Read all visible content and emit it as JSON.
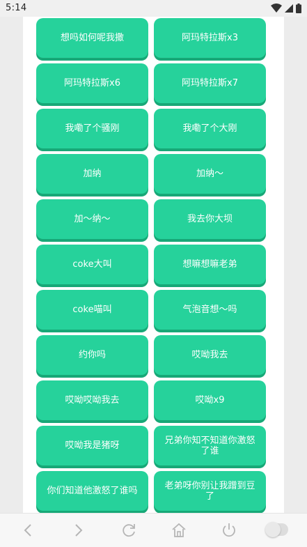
{
  "status_bar": {
    "time": "5:14",
    "icons": [
      "wifi-icon",
      "signal-icon",
      "battery-icon"
    ]
  },
  "colors": {
    "button": "#26d29b",
    "button_shadow": "#17a877",
    "background": "#f0f0f0"
  },
  "buttons": [
    "想吗如何呢我撒",
    "阿玛特拉斯x3",
    "阿玛特拉斯x6",
    "阿玛特拉斯x7",
    "我嘞了个骚刚",
    "我嘞了个大刚",
    "加纳",
    "加纳～",
    "加～纳～",
    "我去你大坝",
    "coke大叫",
    "想嘛想嘛老弟",
    "coke喵叫",
    "气泡音想～吗",
    "约你吗",
    "哎呦我去",
    "哎呦哎呦我去",
    "哎呦x9",
    "哎呦我是猪呀",
    "兄弟你知不知道你激怒了谁",
    "你们知道他激怒了谁吗",
    "老弟呀你别让我蹭到豆了"
  ],
  "bottom_bar": {
    "icons": [
      "back-icon",
      "forward-icon",
      "refresh-icon",
      "home-icon",
      "power-icon",
      "toggle-switch"
    ]
  }
}
